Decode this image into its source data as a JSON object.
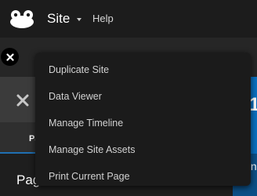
{
  "topbar": {
    "logo_icon": "frog-logo-icon",
    "site_menu_label": "Site",
    "help_label": "Help"
  },
  "site_menu": {
    "items": [
      {
        "label": "Duplicate Site"
      },
      {
        "label": "Data Viewer"
      },
      {
        "label": "Manage Timeline"
      },
      {
        "label": "Manage Site Assets"
      },
      {
        "label": "Print Current Page"
      }
    ]
  },
  "background": {
    "close_icon": "close-icon",
    "tab_partial": "Pa",
    "page_partial": "Pag",
    "blue_digit_partial": "1",
    "blue_text_partial": "In"
  },
  "colors": {
    "topbar": "#1c1c1c",
    "dropdown": "#1b1b1b",
    "accent_blue": "#0a6fbf"
  }
}
